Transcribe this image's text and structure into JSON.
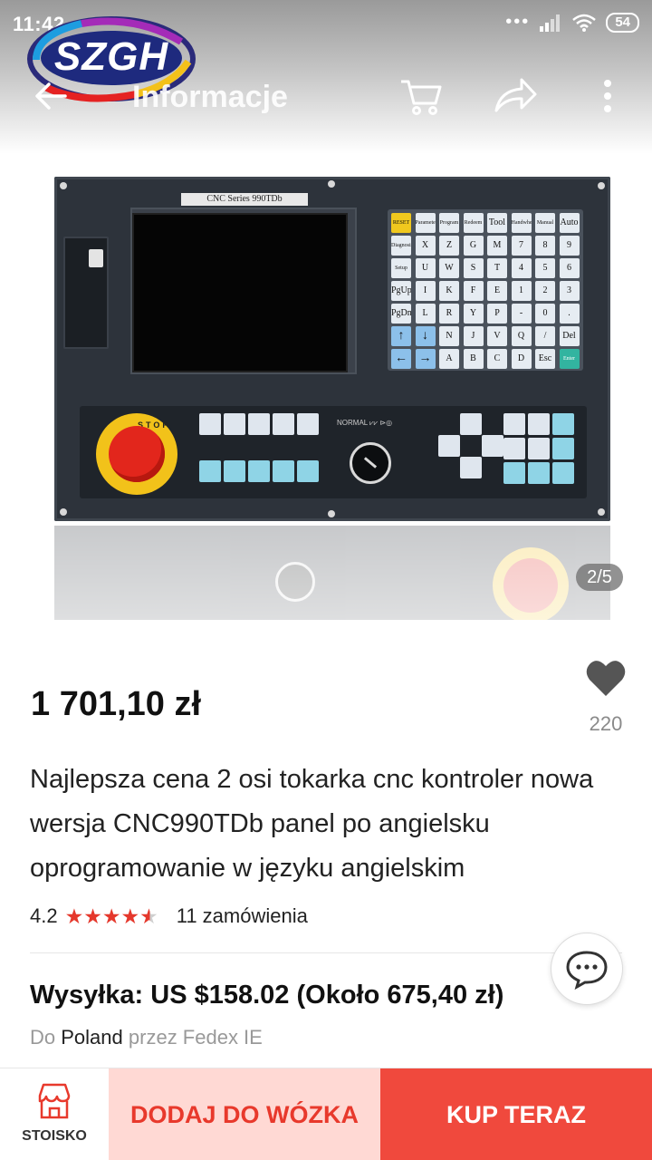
{
  "status_bar": {
    "time": "11:42",
    "battery": "54"
  },
  "logo": {
    "text": "SZGH"
  },
  "app_bar": {
    "title": "Informacje"
  },
  "product_image": {
    "panel_model": "CNC Series 990TDb",
    "page_indicator": "2/5",
    "keys_row1": [
      "RESET",
      "Parameter",
      "Program",
      "Redeem",
      "Tool",
      "Handwheel",
      "Manual",
      "Auto"
    ],
    "keys_row2": [
      "Diagnosis",
      "X",
      "Z",
      "G",
      "M",
      "7",
      "8",
      "9"
    ],
    "keys_row3": [
      "Setup",
      "U",
      "W",
      "S",
      "T",
      "4",
      "5",
      "6"
    ],
    "keys_row4": [
      "PgUp",
      "I",
      "K",
      "F",
      "E",
      "1",
      "2",
      "3"
    ],
    "keys_row5": [
      "PgDn",
      "L",
      "R",
      "Y",
      "P",
      "-",
      "0",
      "."
    ],
    "keys_row6": [
      "↑",
      "↓",
      "N",
      "J",
      "V",
      "Q",
      "/",
      "Del"
    ],
    "keys_row7": [
      "←",
      "→",
      "A",
      "B",
      "C",
      "D",
      "Esc",
      "Enter"
    ]
  },
  "product": {
    "price": "1 701,10 zł",
    "wishlist_count": "220",
    "title": "Najlepsza cena 2 osi tokarka cnc kontroler nowa wersja CNC990TDb panel po angielsku oprogramowanie w języku angielskim",
    "rating": "4.2",
    "rating_value": 4.2,
    "orders": "11 zamówienia"
  },
  "shipping": {
    "headline": "Wysyłka: US $158.02 (Około 675,40 zł)",
    "prefix": "Do",
    "country": "Poland",
    "carrier": "przez Fedex IE"
  },
  "bottom_bar": {
    "store_label": "STOISKO",
    "add_to_cart": "DODAJ DO WÓZKA",
    "buy_now": "KUP TERAZ"
  },
  "colors": {
    "accent": "#f0493d",
    "accent_light": "#ffd9d4",
    "star": "#e5382c"
  }
}
